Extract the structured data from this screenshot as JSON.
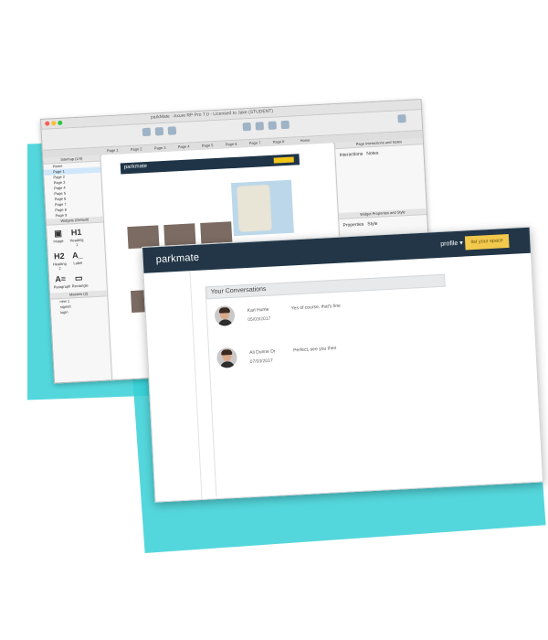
{
  "colors": {
    "splash": "#36d0d6",
    "navbar": "#223647",
    "cta": "#f2c94c"
  },
  "editor": {
    "title": "parkMate · Axure RP Pro 7.0 - Licensed to Jake (STUDENT)",
    "dot_colors": [
      "#fc5f57",
      "#fdbc2e",
      "#28c840"
    ],
    "tabs": [
      "Page 1",
      "Page 2",
      "Page 3",
      "Page 4",
      "Page 5",
      "Page 6",
      "Page 7",
      "Page 8",
      "Home"
    ],
    "pages_panel_title": "Sitemap (1/4)",
    "pages": [
      "Home",
      "Page 1",
      "Page 2",
      "Page 3",
      "Page 4",
      "Page 5",
      "Page 6",
      "Page 7",
      "Page 8",
      "Page 9"
    ],
    "widgets_panel_title": "Widgets (Default)",
    "widgets": [
      {
        "glyph": "▣",
        "label": "Image"
      },
      {
        "glyph": "H1",
        "label": "Heading 1"
      },
      {
        "glyph": "H2",
        "label": "Heading 2"
      },
      {
        "glyph": "A_",
        "label": "Label"
      },
      {
        "glyph": "A≡",
        "label": "Paragraph"
      },
      {
        "glyph": "▭",
        "label": "Rectangle"
      }
    ],
    "masters_panel_title": "Masters (3)",
    "masters": [
      "new 1",
      "signed",
      "login"
    ],
    "right_panel_title": "Page Interactions and Notes",
    "right_tabs": [
      "Interactions",
      "Notes"
    ],
    "right_panel_title_2": "Widget Properties and Style",
    "right_tabs_2": [
      "Properties",
      "Style"
    ],
    "mini_logo": "parkmate"
  },
  "app": {
    "logo": "parkmate",
    "profile_label": "profile ▾",
    "cta_label": "list your space"
  },
  "conversations": {
    "title": "Your Conversations",
    "items": [
      {
        "name": "Karl Hume",
        "date": "05/03/2017",
        "message": "Yes of course, that's fine"
      },
      {
        "name": "Ali Dunne Dr",
        "date": "07/03/2017",
        "message": "Perfect, see you then"
      }
    ]
  }
}
